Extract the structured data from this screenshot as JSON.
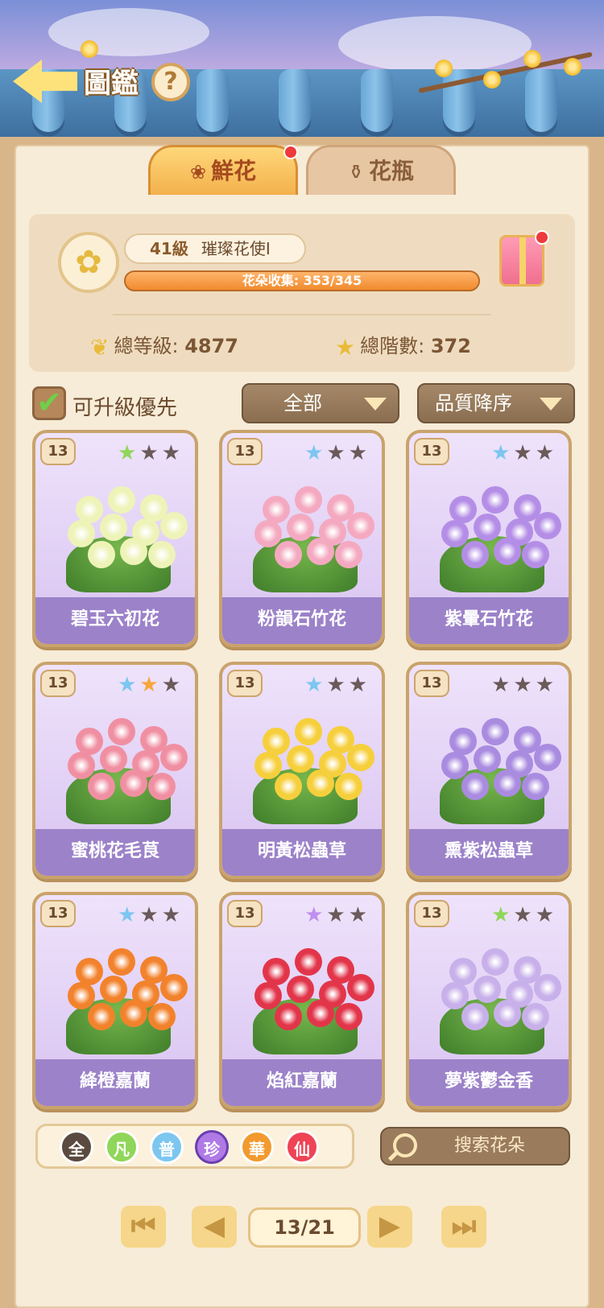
{
  "header": {
    "title": "圖鑑",
    "help_label": "?"
  },
  "tabs": [
    {
      "label": "鮮花",
      "icon": "rose-icon",
      "active": true,
      "badge": true
    },
    {
      "label": "花瓶",
      "icon": "vase-icon",
      "active": false,
      "badge": false
    }
  ],
  "profile": {
    "level": "41級",
    "rank": "璀璨花使I",
    "collection_text": "花朵收集: 353/345",
    "collection_progress": 1.0
  },
  "stats": {
    "total_level_label": "總等級:",
    "total_level": "4877",
    "total_stars_label": "總階數:",
    "total_stars": "372"
  },
  "filters": {
    "upgrade_first": "可升級優先",
    "category": "全部",
    "sort": "品質降序"
  },
  "cards": [
    {
      "level": "13",
      "name": "碧玉六初花",
      "star_color": "#8fd65a",
      "flower": "#eef3b8"
    },
    {
      "level": "13",
      "name": "粉韻石竹花",
      "star_color": "#7cc6f0",
      "flower": "#f4a9c0"
    },
    {
      "level": "13",
      "name": "紫暈石竹花",
      "star_color": "#7cc6f0",
      "flower": "#b48ee6"
    },
    {
      "level": "13",
      "name": "蜜桃花毛茛",
      "star_color": "#7cc6f0",
      "star2": "#f7a63a",
      "flower": "#f08fa2"
    },
    {
      "level": "13",
      "name": "明黃松蟲草",
      "star_color": "#7cc6f0",
      "flower": "#f6cf3c"
    },
    {
      "level": "13",
      "name": "熏紫松蟲草",
      "star_color": "#6b5a5a",
      "flower": "#a98be0"
    },
    {
      "level": "13",
      "name": "絳橙嘉蘭",
      "star_color": "#7cc6f0",
      "flower": "#f2822c"
    },
    {
      "level": "13",
      "name": "焰紅嘉蘭",
      "star_color": "#c08ef0",
      "flower": "#e2354a"
    },
    {
      "level": "13",
      "name": "夢紫鬱金香",
      "star_color": "#8fd65a",
      "flower": "#c8b0ea"
    }
  ],
  "rarities": [
    {
      "label": "全",
      "color": "#5a4a3f"
    },
    {
      "label": "凡",
      "color": "#8fd65a"
    },
    {
      "label": "普",
      "color": "#7cc6f0"
    },
    {
      "label": "珍",
      "color": "#b07ae6"
    },
    {
      "label": "華",
      "color": "#f29a2e"
    },
    {
      "label": "仙",
      "color": "#ee4455"
    }
  ],
  "search": {
    "placeholder": "搜索花朵"
  },
  "pager": {
    "page": "13/21"
  }
}
